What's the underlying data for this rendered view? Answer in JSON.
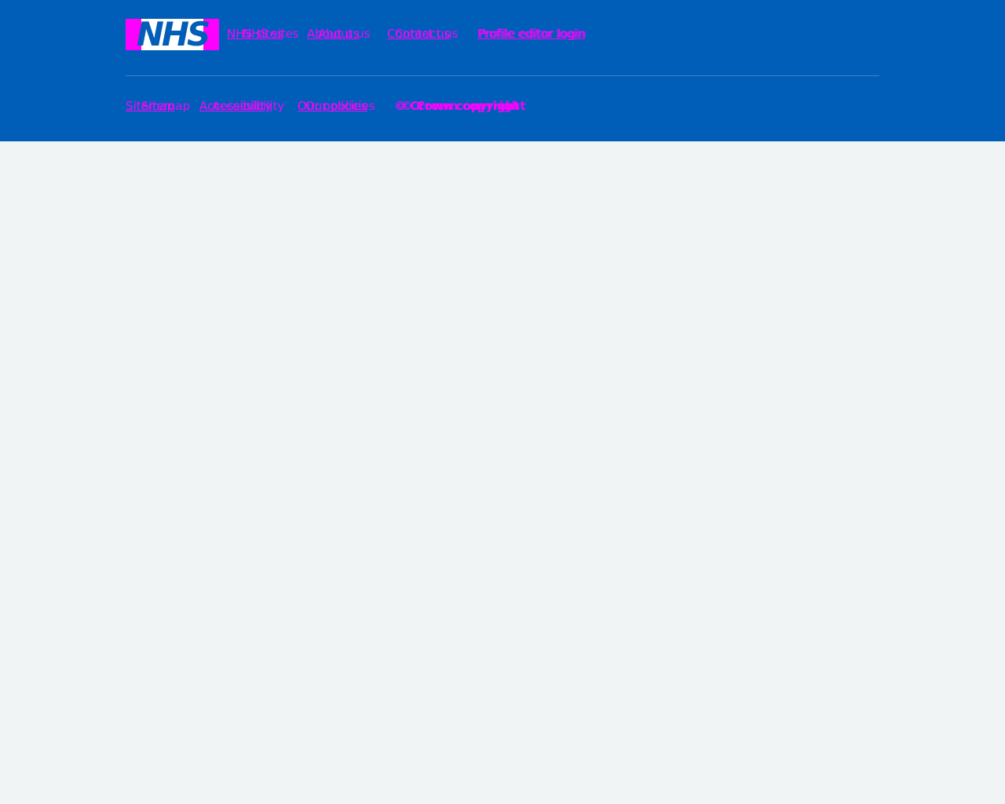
{
  "footer": {
    "logo_text": "NHS",
    "primary_links": [
      {
        "label": "NHS sites"
      },
      {
        "label": "About us"
      },
      {
        "label": "Contact us"
      },
      {
        "label": "Profile editor login"
      }
    ],
    "secondary_links": [
      {
        "label": "Sitemap"
      },
      {
        "label": "Accessibility"
      },
      {
        "label": "Our policies"
      }
    ],
    "copyright": "© Crown copyright"
  },
  "colors": {
    "footer_background": "#005eb8",
    "page_background": "#f0f4f5",
    "link_text": "#ff00ff"
  }
}
